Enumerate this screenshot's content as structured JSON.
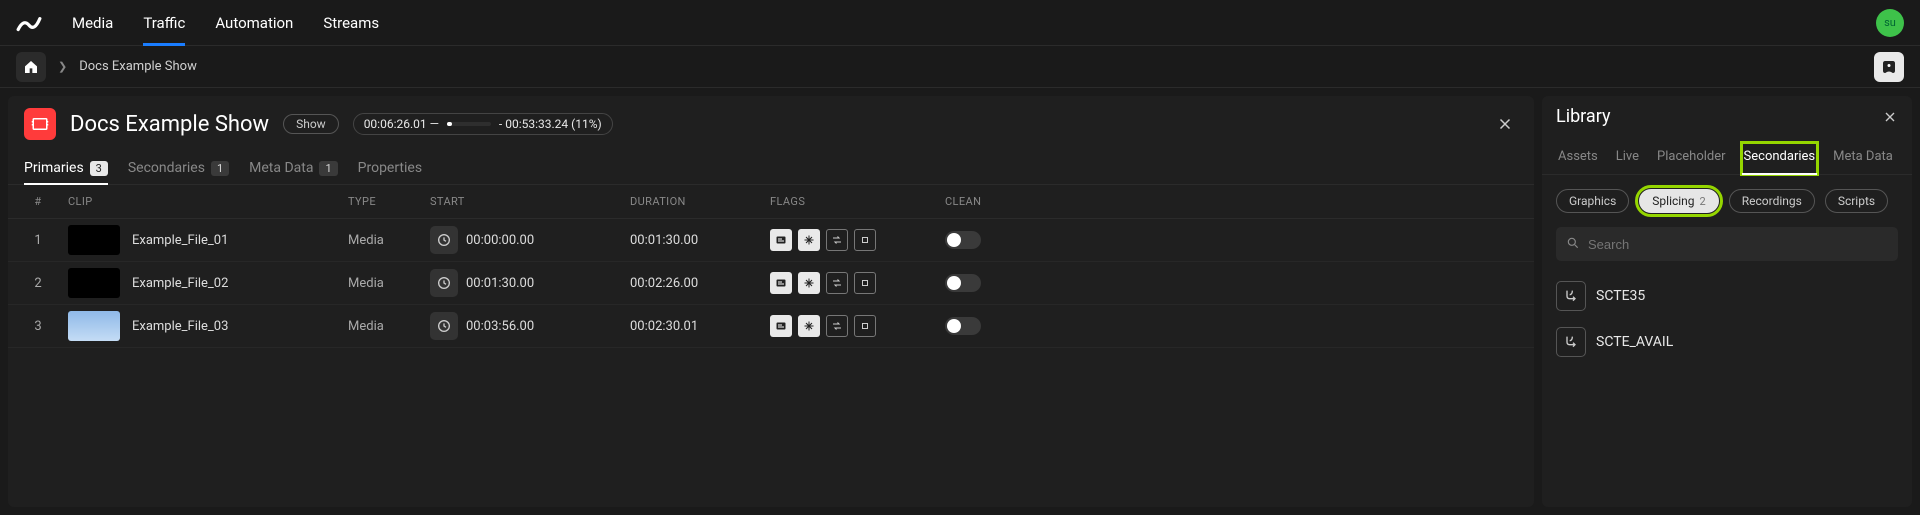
{
  "nav": {
    "items": [
      "Media",
      "Traffic",
      "Automation",
      "Streams"
    ],
    "active_index": 1,
    "avatar_initials": "su"
  },
  "breadcrumb": {
    "items": [
      "Docs Example Show"
    ]
  },
  "main": {
    "icon_color": "#ff3b3b",
    "title": "Docs Example Show",
    "pill": "Show",
    "time_left": "00:06:26.01 —",
    "time_right": "- 00:53:33.24 (11%)",
    "progress_percent": 11,
    "tabs": [
      {
        "label": "Primaries",
        "count": "3",
        "active": true
      },
      {
        "label": "Secondaries",
        "count": "1",
        "active": false
      },
      {
        "label": "Meta Data",
        "count": "1",
        "active": false
      },
      {
        "label": "Properties",
        "count": "",
        "active": false
      }
    ],
    "columns": {
      "idx": "#",
      "clip": "CLIP",
      "type": "TYPE",
      "start": "START",
      "duration": "DURATION",
      "flags": "FLAGS",
      "clean": "CLEAN"
    },
    "rows": [
      {
        "idx": "1",
        "clip": "Example_File_01",
        "thumb": "black",
        "type": "Media",
        "start": "00:00:00.00",
        "duration": "00:01:30.00",
        "clean": false
      },
      {
        "idx": "2",
        "clip": "Example_File_02",
        "thumb": "black",
        "type": "Media",
        "start": "00:01:30.00",
        "duration": "00:02:26.00",
        "clean": false
      },
      {
        "idx": "3",
        "clip": "Example_File_03",
        "thumb": "sky",
        "type": "Media",
        "start": "00:03:56.00",
        "duration": "00:02:30.01",
        "clean": false
      }
    ]
  },
  "library": {
    "title": "Library",
    "tabs": [
      {
        "label": "Assets",
        "active": false,
        "highlight": false
      },
      {
        "label": "Live",
        "active": false,
        "highlight": false
      },
      {
        "label": "Placeholder",
        "active": false,
        "highlight": false
      },
      {
        "label": "Secondaries",
        "active": true,
        "highlight": true
      },
      {
        "label": "Meta Data",
        "active": false,
        "highlight": false
      }
    ],
    "chips": [
      {
        "label": "Graphics",
        "count": "",
        "active": false,
        "highlight": false
      },
      {
        "label": "Splicing",
        "count": "2",
        "active": true,
        "highlight": true
      },
      {
        "label": "Recordings",
        "count": "",
        "active": false,
        "highlight": false
      },
      {
        "label": "Scripts",
        "count": "",
        "active": false,
        "highlight": false
      }
    ],
    "search_placeholder": "Search",
    "items": [
      {
        "label": "SCTE35"
      },
      {
        "label": "SCTE_AVAIL"
      }
    ]
  }
}
